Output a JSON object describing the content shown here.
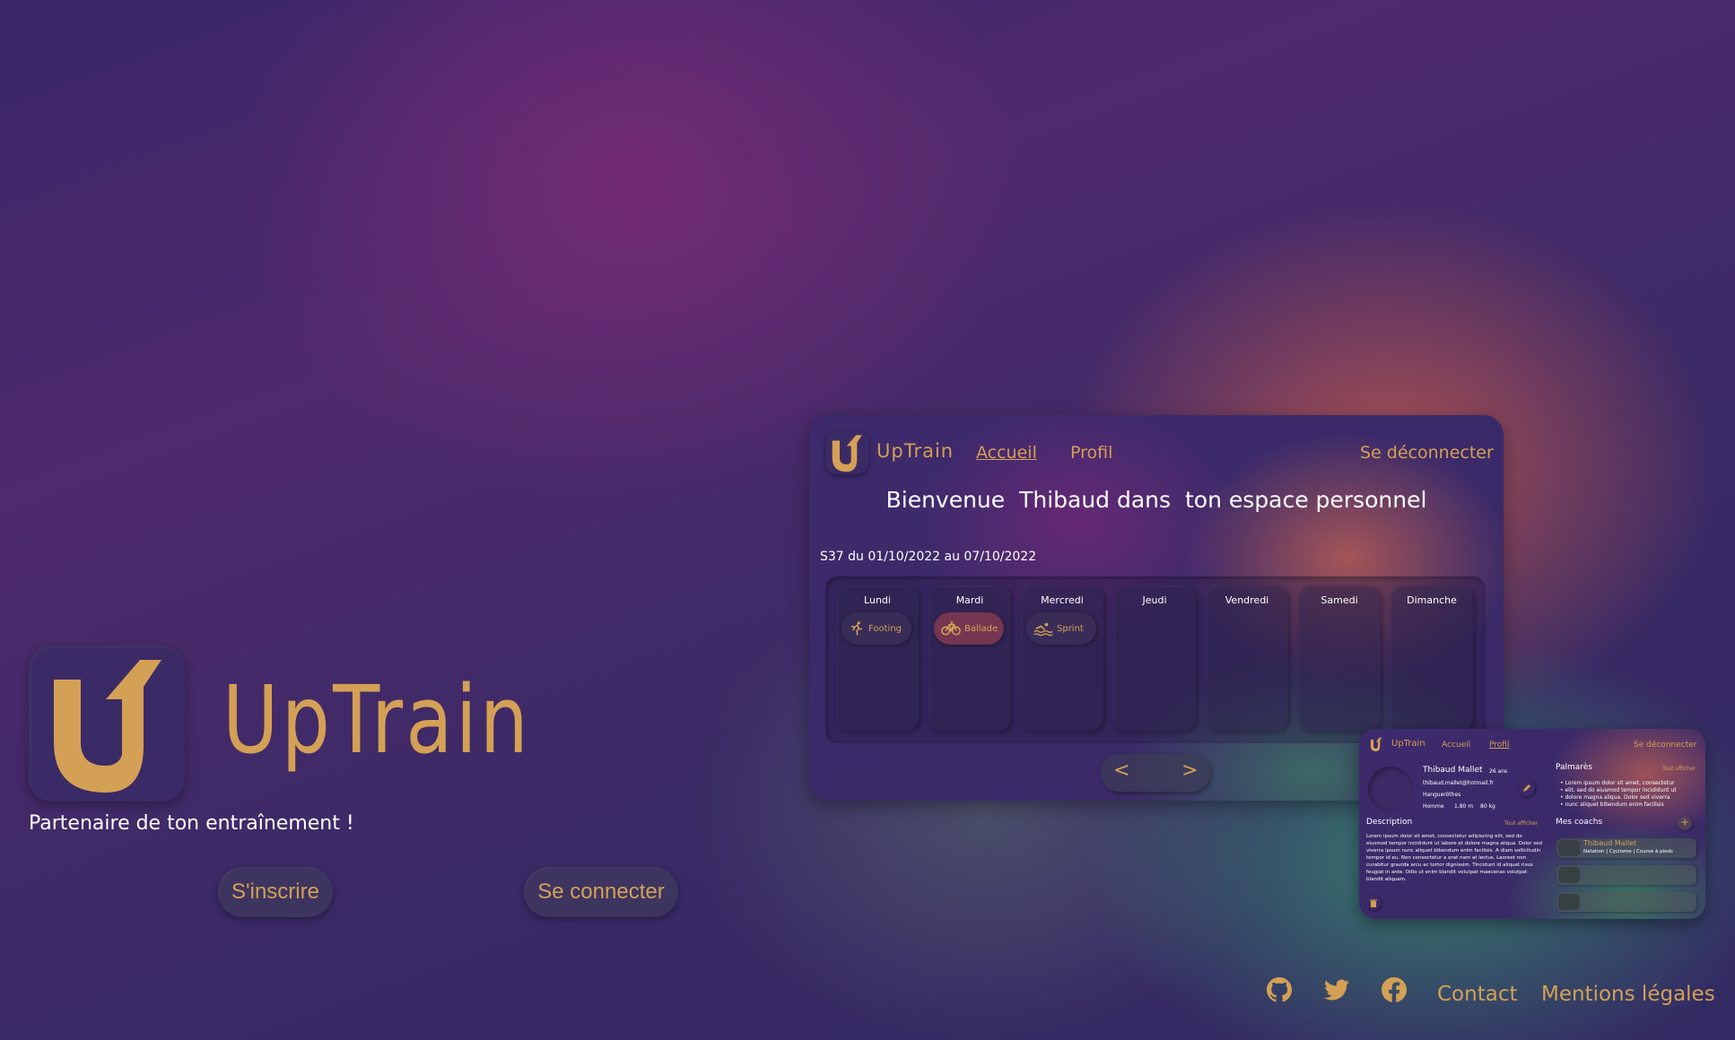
{
  "hero": {
    "app_name": "UpTrain",
    "tagline": "Partenaire de ton entraînement !",
    "signup_label": "S'inscrire",
    "login_label": "Se connecter"
  },
  "preview": {
    "brand": "UpTrain",
    "nav": {
      "home": "Accueil",
      "profile": "Profil",
      "logout": "Se déconnecter"
    },
    "welcome": {
      "part1": "Bienvenue",
      "name": "Thibaud dans",
      "part2": "ton espace personnel"
    },
    "week_label": "S37 du 01/10/2022 au 07/10/2022",
    "days": [
      "Lundi",
      "Mardi",
      "Mercredi",
      "Jeudi",
      "Vendredi",
      "Samedi",
      "Dimanche"
    ],
    "activities": [
      {
        "day": "Lundi",
        "label": "Footing",
        "icon": "running-icon"
      },
      {
        "day": "Mardi",
        "label": "Ballade",
        "icon": "bicycle-icon"
      },
      {
        "day": "Mercredi",
        "label": "Sprint",
        "icon": "swimming-icon"
      }
    ],
    "prev": "<",
    "next": ">"
  },
  "profile_preview": {
    "brand": "UpTrain",
    "nav": {
      "home": "Accueil",
      "profile": "Profil",
      "logout": "Se déconnecter"
    },
    "name": "Thibaud Mallet",
    "age": "26 ans",
    "email": "thibaud.mallet@hotmail.fr",
    "city": "Hangueröthes",
    "gender": "Homme",
    "height": "1,80 m",
    "weight": "80 kg",
    "palmares_title": "Palmarès",
    "show_all": "Tout afficher",
    "palmares_items": [
      "Lorem ipsum dolor sit amet, consectetur",
      "elit, sed do eiusmod tempor incididunt ut",
      "dolore magna aliqua. Dolor sed viverra",
      "nunc aliquet bibendum enim facilisis"
    ],
    "description_title": "Description",
    "description_show": "Tout afficher",
    "description_text": "Lorem ipsum dolor sit amet, consectetur adipiscing elit, sed do eiusmod tempor incididunt ut labore et dolore magna aliqua. Dolor sed viverra ipsum nunc aliquet bibendum enim facilisis. A diam sollicitudin tempor id eu. Non consectetur a erat nam at lectus. Laoreet non curabitur gravida arcu ac tortor dignissim. Tincidunt id aliquet risus feugiat in ante. Odio ut enim blandit volutpat maecenas volutpat blandit aliquam.",
    "coaches_title": "Mes coachs",
    "coach_name": "Thibaud Mallet",
    "coach_sports": "Natation | Cyclisme | Course à pieds"
  },
  "footer": {
    "contact": "Contact",
    "legal": "Mentions légales",
    "icons": [
      "github-icon",
      "twitter-icon",
      "facebook-icon"
    ]
  },
  "colors": {
    "accent": "#d4a055",
    "surface": "#3a2a66"
  }
}
